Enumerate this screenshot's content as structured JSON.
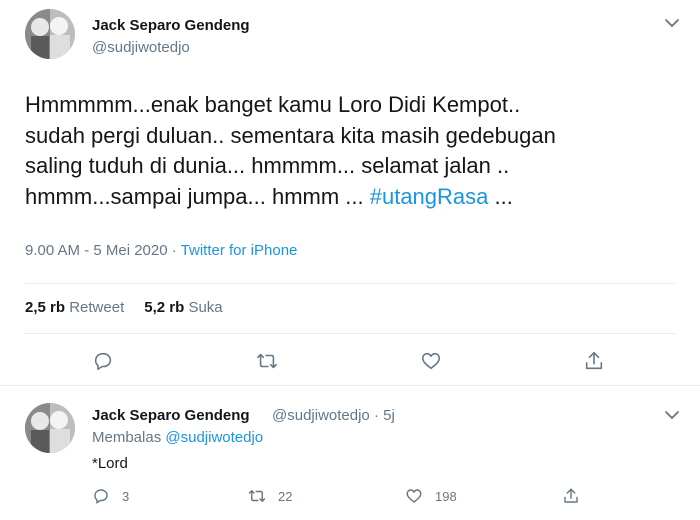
{
  "tweet": {
    "author_name": "Jack Separo Gendeng",
    "author_handle": "@sudjiwotedjo",
    "text": "Hmmmmm...enak banget kamu Loro Didi Kempot..\nsudah pergi duluan.. sementara kita masih gedebugan\nsaling tuduh di dunia... hmmmm... selamat jalan ..\nhmmm...sampai jumpa... hmmm ... ",
    "hashtag": "#utangRasa",
    "text_tail": " ...",
    "timestamp": "9.00 AM - 5 Mei 2020",
    "separator": " · ",
    "source": "Twitter for iPhone",
    "retweet_count": "2,5 rb",
    "retweet_label": "Retweet",
    "like_count": "5,2 rb",
    "like_label": "Suka",
    "actions": [
      "reply-icon",
      "retweet-icon",
      "like-icon",
      "share-icon"
    ]
  },
  "reply": {
    "author_name": "Jack Separo Gendeng",
    "author_handle": "@sudjiwotedjo",
    "separator": " · ",
    "age": "5j",
    "replying_label": "Membalas",
    "replying_mention": "@sudjiwotedjo",
    "text": "*Lord",
    "reply_count": "3",
    "retweet_count": "22",
    "like_count": "198"
  },
  "colors": {
    "link": "#1b95e0",
    "secondary_text": "#657786",
    "primary_text": "#14171a",
    "divider": "#e6ecf0"
  }
}
